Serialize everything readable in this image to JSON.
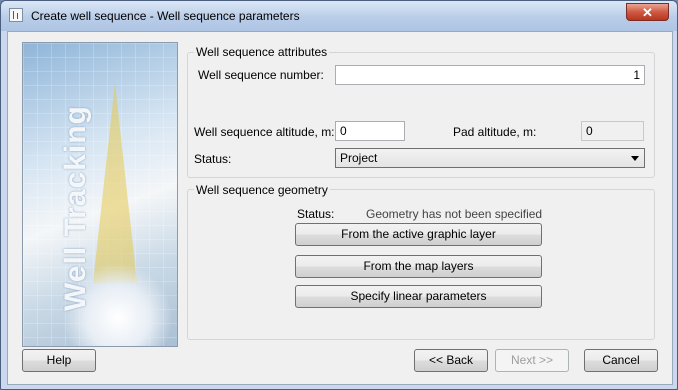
{
  "window": {
    "title": "Create well sequence - Well sequence parameters",
    "close_glyph": "✕"
  },
  "banner": {
    "text": "Well Tracking"
  },
  "attributes": {
    "legend": "Well sequence attributes",
    "number_label": "Well sequence number:",
    "number_value": "1",
    "altitude_label": "Well sequence altitude, m:",
    "altitude_value": "0",
    "pad_label": "Pad altitude, m:",
    "pad_value": "0",
    "status_label": "Status:",
    "status_value": "Project"
  },
  "geometry": {
    "legend": "Well sequence geometry",
    "status_label": "Status:",
    "status_value": "Geometry has not been specified",
    "buttons": [
      "From the active graphic layer",
      "From the map layers",
      "Specify linear parameters"
    ]
  },
  "footer": {
    "help": "Help",
    "back": "<< Back",
    "next": "Next >>",
    "cancel": "Cancel"
  }
}
